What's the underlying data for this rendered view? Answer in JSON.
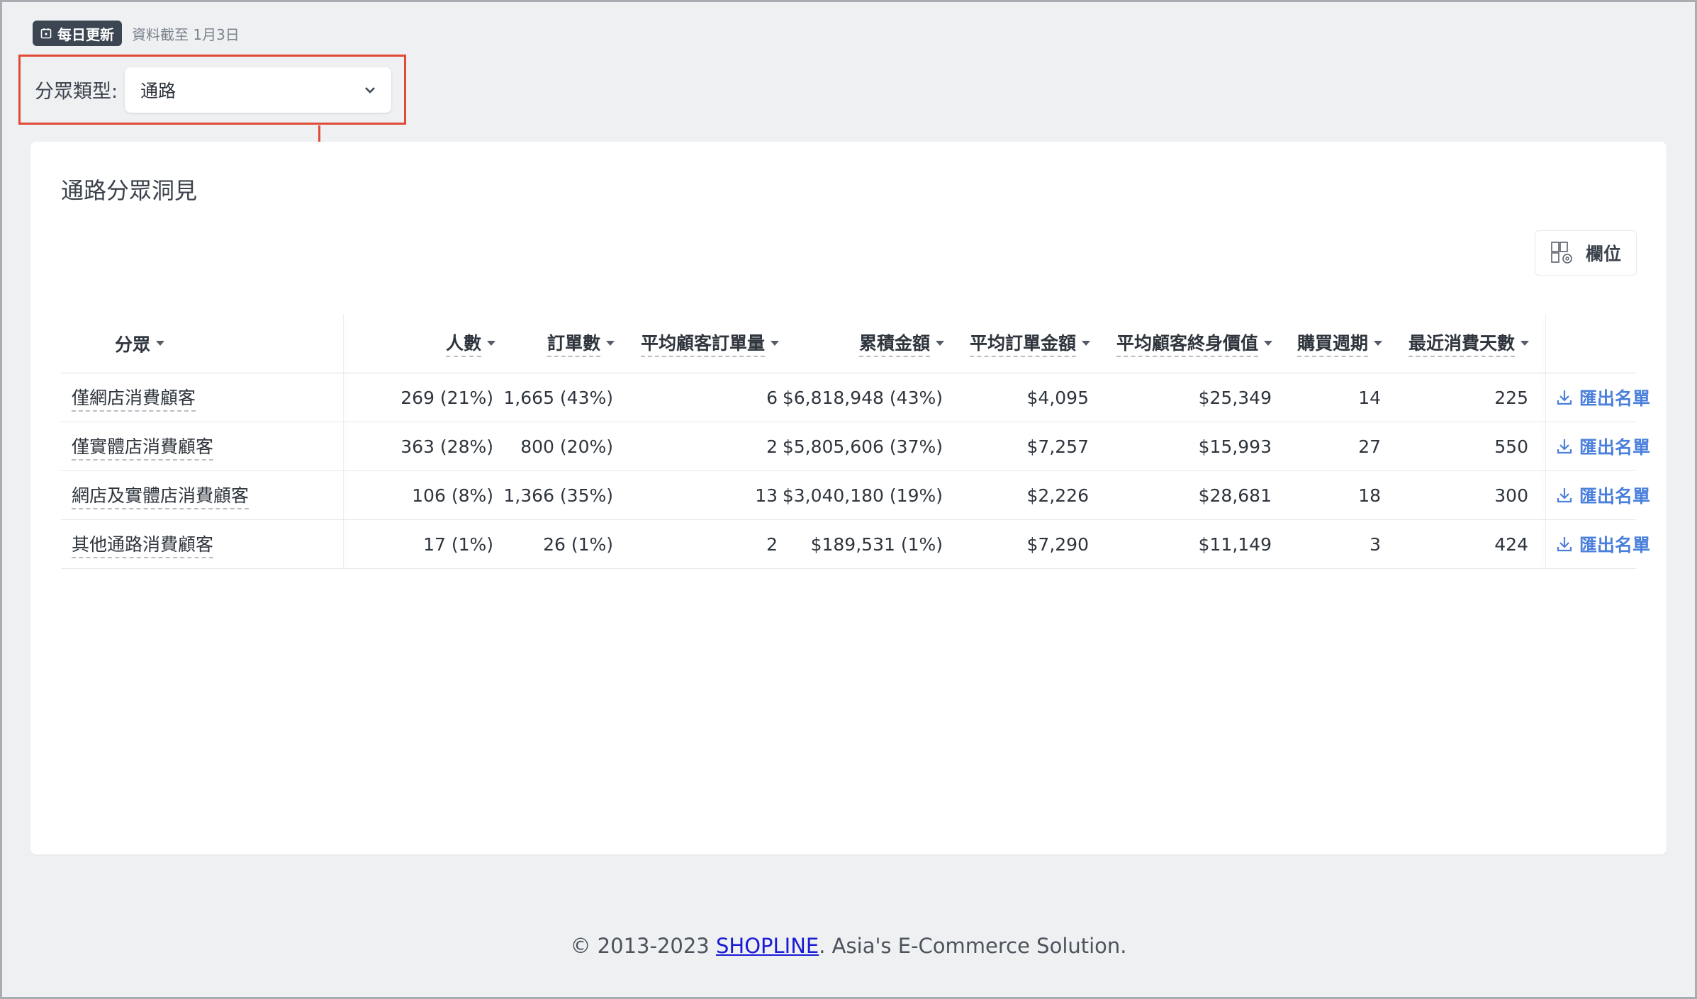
{
  "update_badge": {
    "label": "每日更新",
    "note": "資料截至 1月3日"
  },
  "filter": {
    "label": "分眾類型:",
    "selected": "通路"
  },
  "card": {
    "title": "通路分眾洞見",
    "fields_button": "欄位"
  },
  "table": {
    "headers": {
      "segment": "分眾",
      "people": "人數",
      "orders": "訂單數",
      "avg_orders": "平均顧客訂單量",
      "total_amount": "累積金額",
      "avg_order_amount": "平均訂單金額",
      "avg_ltv": "平均顧客終身價值",
      "purchase_cycle": "購買週期",
      "recent_days": "最近消費天數"
    },
    "export_label": "匯出名單",
    "rows": [
      {
        "segment": "僅網店消費顧客",
        "people": "269 (21%)",
        "orders": "1,665 (43%)",
        "avg_orders": "6",
        "total_amount": "$6,818,948 (43%)",
        "avg_order_amount": "$4,095",
        "avg_ltv": "$25,349",
        "purchase_cycle": "14",
        "recent_days": "225"
      },
      {
        "segment": "僅實體店消費顧客",
        "people": "363 (28%)",
        "orders": "800 (20%)",
        "avg_orders": "2",
        "total_amount": "$5,805,606 (37%)",
        "avg_order_amount": "$7,257",
        "avg_ltv": "$15,993",
        "purchase_cycle": "27",
        "recent_days": "550"
      },
      {
        "segment": "網店及實體店消費顧客",
        "people": "106 (8%)",
        "orders": "1,366 (35%)",
        "avg_orders": "13",
        "total_amount": "$3,040,180 (19%)",
        "avg_order_amount": "$2,226",
        "avg_ltv": "$28,681",
        "purchase_cycle": "18",
        "recent_days": "300"
      },
      {
        "segment": "其他通路消費顧客",
        "people": "17 (1%)",
        "orders": "26 (1%)",
        "avg_orders": "2",
        "total_amount": "$189,531 (1%)",
        "avg_order_amount": "$7,290",
        "avg_ltv": "$11,149",
        "purchase_cycle": "3",
        "recent_days": "424"
      }
    ]
  },
  "footer": {
    "prefix": "© 2013-2023 ",
    "link": "SHOPLINE",
    "suffix": ". Asia's E-Commerce Solution."
  },
  "colors": {
    "accent": "#4a7fdb",
    "highlight": "#e04a37",
    "badge_bg": "#3c4552"
  }
}
